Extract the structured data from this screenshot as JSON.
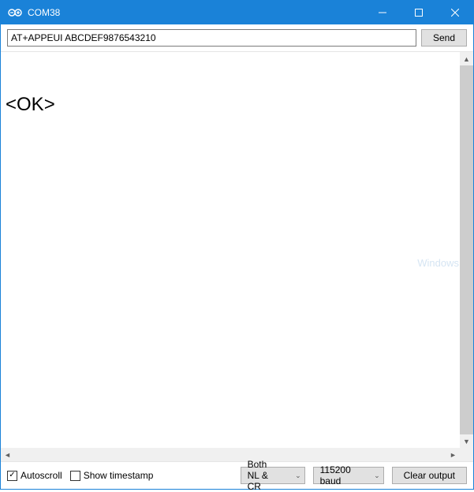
{
  "window": {
    "title": "COM38"
  },
  "topbar": {
    "command_value": "AT+APPEUI ABCDEF9876543210",
    "send_label": "Send"
  },
  "output": {
    "text": "\n<OK>"
  },
  "watermark": {
    "text": "Windows"
  },
  "bottombar": {
    "autoscroll": {
      "label": "Autoscroll",
      "checked": true
    },
    "timestamp": {
      "label": "Show timestamp",
      "checked": false
    },
    "line_ending": {
      "selected": "Both NL & CR"
    },
    "baud": {
      "selected": "115200 baud"
    },
    "clear_label": "Clear output"
  }
}
